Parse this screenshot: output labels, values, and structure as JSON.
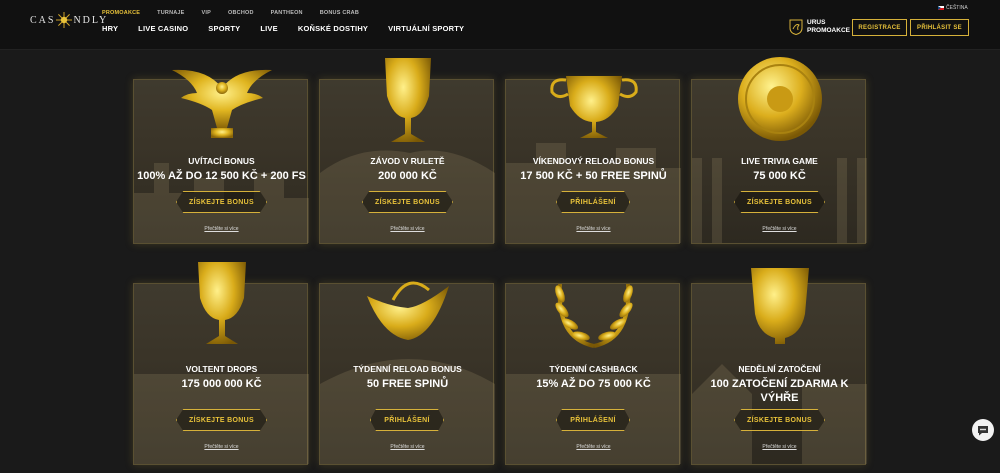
{
  "header": {
    "logo_left": "CAS",
    "logo_right": "NDLY",
    "top_nav": [
      "PROMOAKCE",
      "TURNAJE",
      "VIP",
      "OBCHOD",
      "PANTHEON",
      "BONUS CRAB"
    ],
    "main_nav": [
      "HRY",
      "LIVE CASINO",
      "SPORTY",
      "LIVE",
      "KOŇSKÉ DOSTIHY",
      "VIRTUÁLNÍ SPORTY"
    ],
    "language": "ČEŠTINA",
    "promo_line1": "URUS",
    "promo_line2": "PROMOAKCE",
    "register": "REGISTRACE",
    "login": "PŘIHLÁSIT SE"
  },
  "promotions": [
    {
      "title": "UVÍTACÍ BONUS",
      "prize": "100% AŽ DO 12 500 KČ + 200 FS",
      "cta": "ZÍSKEJTE BONUS",
      "more": "Přečtěte si více",
      "art": "golden-eagle-icon"
    },
    {
      "title": "ZÁVOD V RULETĚ",
      "prize": "200 000 KČ",
      "cta": "ZÍSKEJTE BONUS",
      "more": "Přečtěte si více",
      "art": "golden-goblet-icon"
    },
    {
      "title": "VÍKENDOVÝ RELOAD BONUS",
      "prize": "17 500 KČ + 50 FREE SPINŮ",
      "cta": "PŘIHLÁŠENÍ",
      "more": "Přečtěte si více",
      "art": "golden-cup-icon"
    },
    {
      "title": "LIVE TRIVIA GAME",
      "prize": "75 000 KČ",
      "cta": "ZÍSKEJTE BONUS",
      "more": "Přečtěte si více",
      "art": "golden-shield-icon"
    },
    {
      "title": "VOLTENT DROPS",
      "prize": "175 000 000 KČ",
      "cta": "ZÍSKEJTE BONUS",
      "more": "Přečtěte si více",
      "art": "golden-chalice-icon"
    },
    {
      "title": "TÝDENNÍ RELOAD BONUS",
      "prize": "50 FREE SPINŮ",
      "cta": "PŘIHLÁŠENÍ",
      "more": "Přečtěte si více",
      "art": "golden-boat-bowl-icon"
    },
    {
      "title": "TÝDENNÍ CASHBACK",
      "prize": "15% AŽ DO 75 000 KČ",
      "cta": "PŘIHLÁŠENÍ",
      "more": "Přečtěte si více",
      "art": "laurel-wreath-icon"
    },
    {
      "title": "NEDĚLNÍ ZATOČENÍ",
      "prize": "100 ZATOČENÍ ZDARMA K VÝHŘE",
      "cta": "ZÍSKEJTE BONUS",
      "more": "Přečtěte si více",
      "art": "golden-vase-icon"
    }
  ],
  "colors": {
    "gold": "#e8c23a",
    "gold_border": "#d6b13a",
    "background": "#1a1a1a",
    "header": "#111111"
  }
}
